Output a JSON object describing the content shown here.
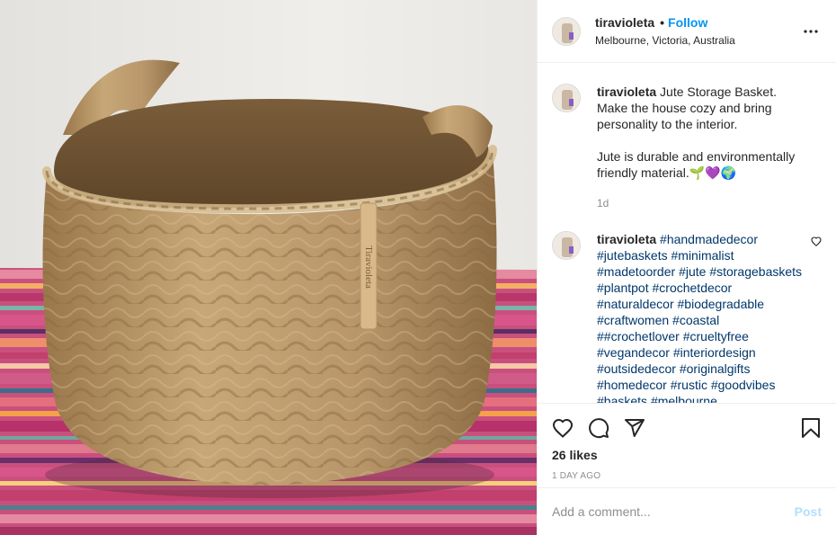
{
  "photo": {
    "label_text": "Tiravioleta",
    "colors": {
      "background": "#ecebe8",
      "jute": "#b08d5e",
      "stripes": [
        "#c2406d",
        "#e07a8c",
        "#f4a24a",
        "#6fa8a0",
        "#6a2f6b",
        "#f3c9a6",
        "#d8558a",
        "#3d6d8a"
      ]
    }
  },
  "header": {
    "username": "tiravioleta",
    "separator": "•",
    "follow_label": "Follow",
    "location": "Melbourne, Victoria, Australia",
    "more_icon": "more-horizontal-icon"
  },
  "caption": {
    "username": "tiravioleta",
    "text": "Jute Storage Basket.\nMake the house cozy and bring personality to the interior.\n\nJute is durable and environmentally friendly material.",
    "emojis": "🌱💜🌍",
    "time": "1d"
  },
  "comment": {
    "username": "tiravioleta",
    "hashtags": [
      "#handmadedecor",
      "#jutebaskets",
      "#minimalist",
      "#madetoorder",
      "#jute",
      "#storagebaskets",
      "#plantpot",
      "#crochetdecor",
      "#naturaldecor",
      "#biodegradable",
      "#craftwomen",
      "#coastal",
      "##crochetlover",
      "#crueltyfree",
      "#vegandecor",
      "#interiordesign",
      "#outsidedecor",
      "#originalgifts",
      "#homedecor",
      "#rustic",
      "#goodvibes",
      "#baskets",
      "#melbourne"
    ],
    "like_icon": "heart-outline-icon"
  },
  "actions": {
    "icons": [
      "heart-outline-icon",
      "comment-icon",
      "share-icon",
      "bookmark-icon"
    ],
    "likes": "26 likes",
    "time_ago": "1 DAY AGO"
  },
  "add_comment": {
    "placeholder": "Add a comment...",
    "post_label": "Post",
    "post_color": "#b2dffc"
  },
  "colors": {
    "accent": "#0095f6",
    "hashtag": "#00376b",
    "muted": "#8e8e8e",
    "border": "#efefef"
  }
}
